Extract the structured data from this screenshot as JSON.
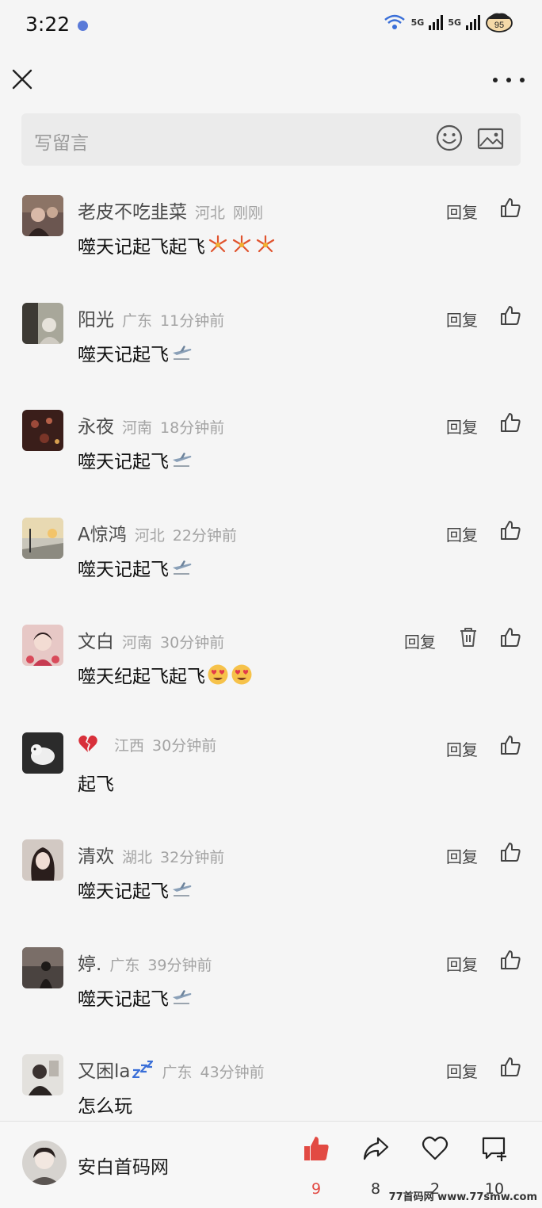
{
  "status_bar": {
    "time": "3:22",
    "network_1": "5G",
    "network_2": "5G",
    "battery": "95"
  },
  "top_bar": {
    "close_icon": "close-icon",
    "more_icon": "more-icon"
  },
  "comment_box": {
    "placeholder": "写留言",
    "emoji_icon": "smiley-icon",
    "image_icon": "image-icon"
  },
  "comments": [
    {
      "name": "老皮不吃韭菜",
      "region": "河北",
      "time": "刚刚",
      "text": "噬天记起飞起飞",
      "emojis": [
        "fireworks",
        "fireworks",
        "fireworks"
      ],
      "reply": "回复",
      "can_delete": false
    },
    {
      "name": "阳光",
      "region": "广东",
      "time": "11分钟前",
      "text": "噬天记起飞",
      "emojis": [
        "airplane"
      ],
      "reply": "回复",
      "can_delete": false
    },
    {
      "name": "永夜",
      "region": "河南",
      "time": "18分钟前",
      "text": "噬天记起飞",
      "emojis": [
        "airplane"
      ],
      "reply": "回复",
      "can_delete": false
    },
    {
      "name": "A惊鸿",
      "region": "河北",
      "time": "22分钟前",
      "text": "噬天记起飞",
      "emojis": [
        "airplane"
      ],
      "reply": "回复",
      "can_delete": false
    },
    {
      "name": "文白",
      "region": "河南",
      "time": "30分钟前",
      "text": "噬天纪起飞起飞",
      "emojis": [
        "heart-eyes",
        "heart-eyes"
      ],
      "reply": "回复",
      "can_delete": true
    },
    {
      "name": "",
      "name_emoji": "broken-heart",
      "region": "江西",
      "time": "30分钟前",
      "text": "起飞",
      "emojis": [],
      "reply": "回复",
      "can_delete": false
    },
    {
      "name": "清欢",
      "region": "湖北",
      "time": "32分钟前",
      "text": "噬天记起飞",
      "emojis": [
        "airplane"
      ],
      "reply": "回复",
      "can_delete": false
    },
    {
      "name": "婷.",
      "region": "广东",
      "time": "39分钟前",
      "text": "噬天记起飞",
      "emojis": [
        "airplane"
      ],
      "reply": "回复",
      "can_delete": false
    },
    {
      "name": "又困la",
      "name_emoji": "zzz",
      "region": "广东",
      "time": "43分钟前",
      "text": "怎么玩",
      "emojis": [],
      "reply": "回复",
      "can_delete": false
    }
  ],
  "footer": {
    "account_name": "安白首码网",
    "like_count": "9",
    "share_count": "8",
    "favorite_count": "2",
    "comment_count": "10",
    "accent_color": "#e24a43"
  },
  "watermark": "77首码网 www.77smw.com"
}
